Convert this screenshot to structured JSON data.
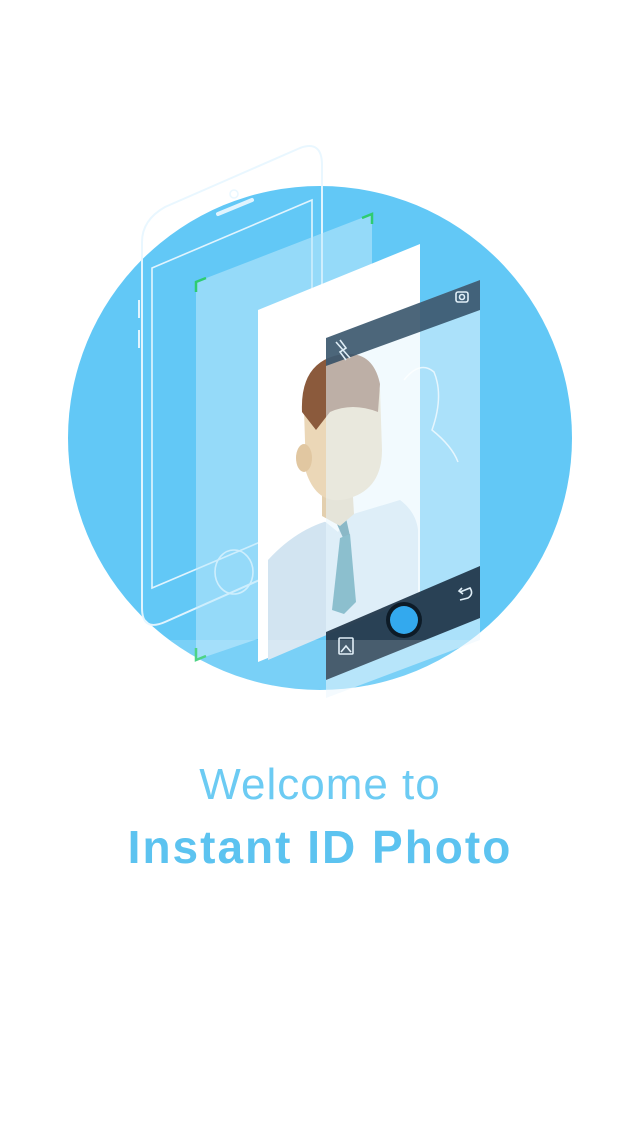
{
  "welcome": {
    "line1": "Welcome to",
    "line2": "Instant ID Photo"
  },
  "colors": {
    "circle": "#62c8f6",
    "accent_text": "#5cc3f0",
    "camera_bar": "#2f4b63",
    "shutter": "#33a9ee",
    "corner_marks": "#2ecc71"
  },
  "icons": [
    "flash-off-icon",
    "switch-camera-icon",
    "gallery-icon",
    "shutter-button-icon",
    "undo-icon"
  ]
}
